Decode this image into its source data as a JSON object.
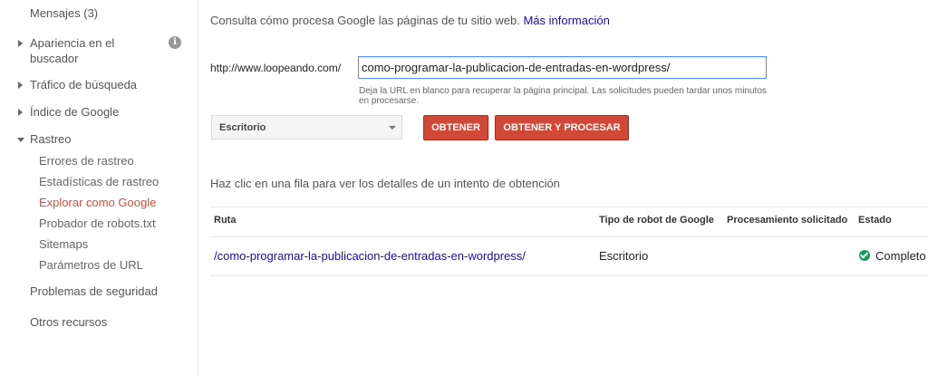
{
  "sidebar": {
    "mensajes": "Mensajes (3)",
    "apariencia": "Apariencia en el buscador",
    "info_icon": "i",
    "trafico": "Tráfico de búsqueda",
    "indice": "Índice de Google",
    "rastreo": "Rastreo",
    "rastreo_items": [
      "Errores de rastreo",
      "Estadísticas de rastreo",
      "Explorar como Google",
      "Probador de robots.txt",
      "Sitemaps",
      "Parámetros de URL"
    ],
    "seguridad": "Problemas de seguridad",
    "otros": "Otros recursos"
  },
  "main": {
    "intro": "Consulta cómo procesa Google las páginas de tu sitio web.",
    "intro_link": "Más información",
    "prefix": "http://www.loopeando.com/",
    "url_value": "como-programar-la-publicacion-de-entradas-en-wordpress/",
    "hint": "Deja la URL en blanco para recuperar la página principal. Las solicitudes pueden tardar unos minutos en procesarse.",
    "device": "Escritorio",
    "fetch_btn": "OBTENER",
    "fetch_render_btn": "OBTENER Y PROCESAR",
    "table_hint": "Haz clic en una fila para ver los detalles de un intento de obtención"
  },
  "table": {
    "headers": [
      "Ruta",
      "Tipo de robot de Google",
      "Procesamiento solicitado",
      "Estado"
    ],
    "rows": [
      {
        "ruta": "/como-programar-la-publicacion-de-entradas-en-wordpress/",
        "robot": "Escritorio",
        "procesamiento": "",
        "estado": "Completo"
      }
    ]
  },
  "colors": {
    "accent": "#dd4b39",
    "button": "#d14836",
    "link": "#1a0dab",
    "success": "#0f9d58"
  }
}
